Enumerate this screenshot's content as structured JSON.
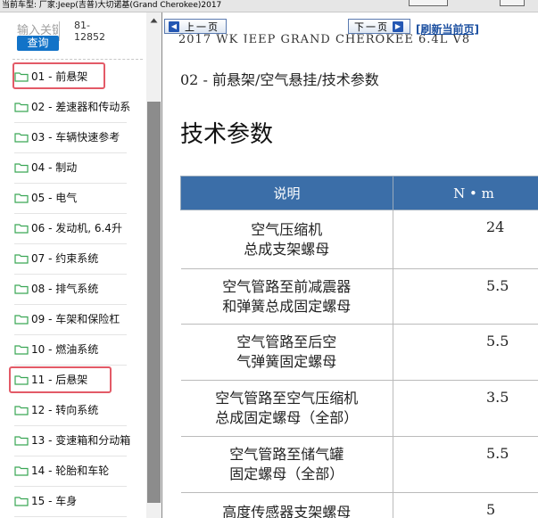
{
  "topbar": {
    "vehicle_label": "当前车型:  厂家:Jeep(吉普)大切诺基(Grand Cherokee)2017"
  },
  "sidebar": {
    "search": {
      "placeholder": "输入关键",
      "code_line1": "81-",
      "code_line2": "12852",
      "query_label": "查询"
    },
    "items": [
      {
        "label": "01 - 前悬架",
        "highlighted": true
      },
      {
        "label": "02 - 差速器和传动系",
        "highlighted": false
      },
      {
        "label": "03 - 车辆快速参考",
        "highlighted": false
      },
      {
        "label": "04 - 制动",
        "highlighted": false
      },
      {
        "label": "05 - 电气",
        "highlighted": false
      },
      {
        "label": "06 - 发动机, 6.4升",
        "highlighted": false
      },
      {
        "label": "07 - 约束系统",
        "highlighted": false
      },
      {
        "label": "08 - 排气系统",
        "highlighted": false
      },
      {
        "label": "09 - 车架和保险杠",
        "highlighted": false
      },
      {
        "label": "10 - 燃油系统",
        "highlighted": false
      },
      {
        "label": "11 - 后悬架",
        "highlighted": true
      },
      {
        "label": "12 - 转向系统",
        "highlighted": false
      },
      {
        "label": "13 - 变速箱和分动箱",
        "highlighted": false
      },
      {
        "label": "14 - 轮胎和车轮",
        "highlighted": false
      },
      {
        "label": "15 - 车身",
        "highlighted": false
      }
    ]
  },
  "content": {
    "prev_label": "上一页",
    "next_label": "下一页",
    "refresh_label": "[刷新当前页]",
    "doc_header": "2017   WK   JEEP GRAND CHEROKEE   6.4L V8",
    "section_path": "02 - 前悬架/空气悬挂/技术参数",
    "page_title": "技术参数",
    "table": {
      "headers": [
        "说明",
        "N • m"
      ],
      "rows": [
        {
          "desc1": "空气压缩机",
          "desc2": "总成支架螺母",
          "value": "24"
        },
        {
          "desc1": "空气管路至前减震器",
          "desc2": "和弹簧总成固定螺母",
          "value": "5.5"
        },
        {
          "desc1": "空气管路至后空",
          "desc2": "气弹簧固定螺母",
          "value": "5.5"
        },
        {
          "desc1": "空气管路至空气压缩机",
          "desc2": "总成固定螺母（全部）",
          "value": "3.5"
        },
        {
          "desc1": "空气管路至储气罐",
          "desc2": "固定螺母（全部）",
          "value": "5.5"
        },
        {
          "desc1": "高度传感器支架螺母",
          "desc2": "",
          "value": "5"
        }
      ]
    }
  },
  "colors": {
    "query_button": "#1273c8",
    "table_header": "#3b6ea8",
    "highlight": "#e35a67",
    "link": "#1b4fa0"
  }
}
